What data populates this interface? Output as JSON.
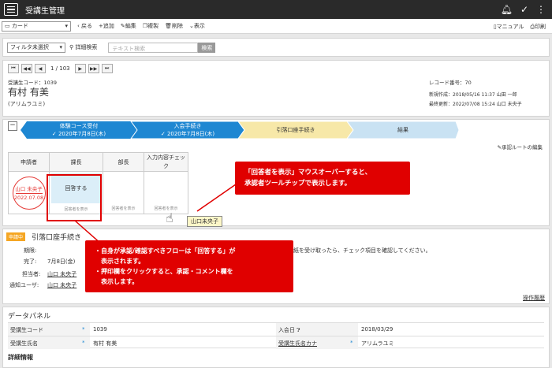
{
  "app": {
    "title": "受講生管理"
  },
  "toolbar": {
    "view": "カード",
    "back": "戻る",
    "add": "追加",
    "edit": "編集",
    "copy": "複製",
    "delete": "削除",
    "display": "表示",
    "manual": "マニュアル",
    "print": "印刷"
  },
  "filter": {
    "select": "フィルタ未選択",
    "detail": "詳細検索",
    "placeholder": "テキスト検索",
    "search": "検索"
  },
  "pager": {
    "text": "1 / 103"
  },
  "record": {
    "student_code_label": "受講生コード：1039",
    "name": "有村 有美",
    "kana": "(アリムラユミ)",
    "record_no": "レコード番号：70",
    "created": "新規作成：2018/05/16 11:37 山田 一郎",
    "updated": "最終更新：2022/07/08 15:24 山口 未央子"
  },
  "flow": {
    "steps": [
      {
        "title": "体験コース受付",
        "date": "✓ 2020年7月8日(木)"
      },
      {
        "title": "入会手続き",
        "date": "✓ 2020年7月8日(木)"
      },
      {
        "title": "引落口座手続き",
        "date": ""
      },
      {
        "title": "結果",
        "date": ""
      }
    ],
    "edit_route": "承認ルートの編集",
    "headers": [
      "申請者",
      "課長",
      "部長",
      "入力内容チェック"
    ],
    "stamp_name": "山口 未央子",
    "stamp_date": "2022.07.08",
    "respond": "回答する",
    "sub_labels": [
      "回答者を表示",
      "回答者を表示",
      "回答者を表示"
    ],
    "tooltip": "山口未央子"
  },
  "app_panel": {
    "badge": "申請中",
    "title": "引落口座手続き",
    "period_label": "期限:",
    "done_label": "完了:",
    "done_value": "7月8日(金)",
    "owner_label": "担当者:",
    "owner_value": "山口 未央子",
    "notify_label": "通知ユーザ:",
    "notify_value": "山口 未央子",
    "memo": "紙を受け取ったら、チェック項目を確認してください。",
    "history": "操作履歴"
  },
  "data_panel": {
    "title": "データパネル",
    "rows": [
      {
        "l1": "受講生コード",
        "v1": "1039",
        "l2": "入会日",
        "v2": "2018/03/29"
      },
      {
        "l1": "受講生氏名",
        "v1": "有村 有美",
        "l2": "受講生氏名カナ",
        "v2": "アリムラユミ"
      }
    ],
    "detail": "詳細情報"
  },
  "callouts": {
    "tooltip_note": "「回答者を表示」マウスオーバーすると、\n承認者ツールチップで表示します。",
    "flow_note": "・自身が承認/確認すべきフローは「回答する」が\n　表示されます。\n・押印欄をクリックすると、承認・コメント欄を\n　表示します。"
  },
  "colors": {
    "accent": "#e00000",
    "step_done": "#1e87d2",
    "step_current": "#f7e8a8",
    "step_future": "#c9e2f3"
  }
}
